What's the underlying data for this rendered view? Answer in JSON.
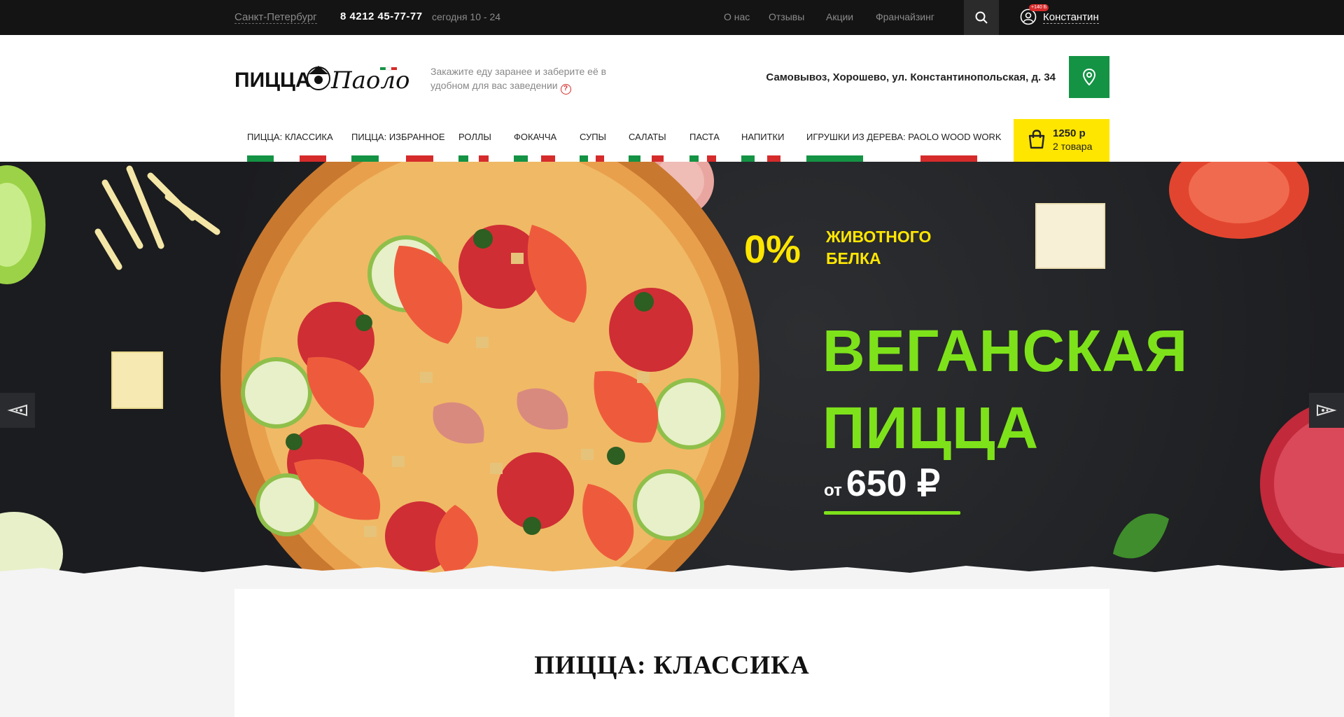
{
  "topbar": {
    "city": "Санкт-Петербург",
    "phone": "8 4212 45-77-77",
    "hours": "сегодня 10 - 24",
    "nav": [
      "О нас",
      "Отзывы",
      "Акции",
      "Франчайзинг"
    ],
    "bonus": "+140 Б",
    "user_name": "Константин"
  },
  "header": {
    "logo_text": "ПИЦЦА Паоло",
    "tagline": "Закажите еду заранее и заберите её в удобном для вас заведении",
    "address": "Самовывоз, Хорошево, ул. Константинопольская, д. 34"
  },
  "menu": [
    "Пицца: классика",
    "Пицца: избранное",
    "Роллы",
    "Фокачча",
    "Супы",
    "Салаты",
    "Паста",
    "Напитки",
    "Игрушки из дерева: Paolo Wood Work"
  ],
  "cart": {
    "sum": "1250 р",
    "count": "2 товара"
  },
  "banner": {
    "zero": "0%",
    "sub": "ЖИВОТНОГО БЕЛКА",
    "title_line1": "ВЕГАНСКАЯ",
    "title_line2": "ПИЦЦА",
    "price_prefix": "от",
    "price": "650 ₽"
  },
  "section": {
    "title": "ПИЦЦА: КЛАССИКА"
  },
  "colors": {
    "green": "#149344",
    "red": "#d62b2b",
    "yellow": "#ffe600",
    "lime": "#7ee21b"
  }
}
